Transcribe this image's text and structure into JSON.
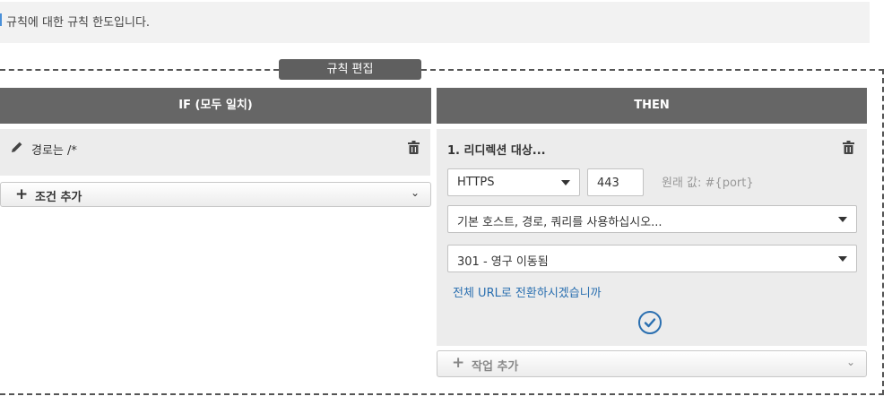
{
  "info": {
    "text": "규칙에 대한 규칙 한도입니다."
  },
  "editor": {
    "tab_label": "규칙 편집"
  },
  "if_column": {
    "header": "IF (모두 일치)",
    "condition": {
      "text": "경로는 /*",
      "edit_icon": "pencil-icon",
      "delete_icon": "trash-icon"
    },
    "add_condition": {
      "label": "조건 추가",
      "icon": "plus-icon",
      "chevron": "chevron-down-icon"
    }
  },
  "then_column": {
    "header": "THEN",
    "action": {
      "title": "1. 리디렉션 대상...",
      "delete_icon": "trash-icon",
      "protocol": {
        "value": "HTTPS"
      },
      "port": {
        "value": "443"
      },
      "port_hint": "원래 값: #{port}",
      "host_path_query": {
        "value": "기본 호스트, 경로, 쿼리를 사용하십시오..."
      },
      "status_code": {
        "value": "301 - 영구 이동됨"
      },
      "full_url_link": "전체 URL로 전환하시겠습니까",
      "confirm_icon": "check-circle-icon"
    },
    "add_action": {
      "label": "작업 추가",
      "icon": "plus-icon",
      "chevron": "chevron-down-icon"
    }
  },
  "colors": {
    "header_bg": "#666666",
    "panel_bg": "#ececec",
    "info_bg": "#f2f2f2",
    "link": "#2a6fb0",
    "accent": "#4a90d9"
  }
}
